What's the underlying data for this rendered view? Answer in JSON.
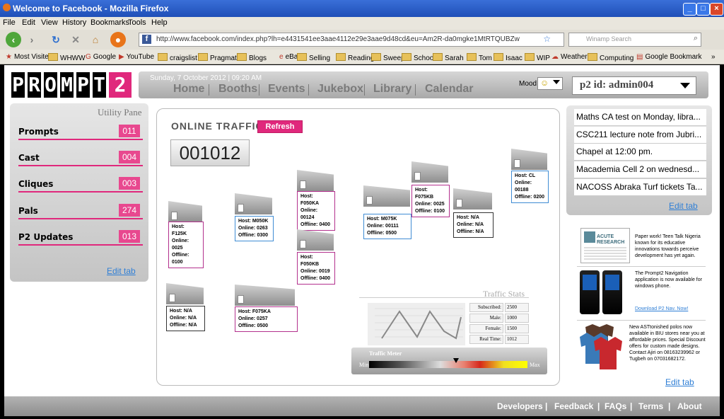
{
  "browser": {
    "window_title": "Welcome to Facebook - Mozilla Firefox",
    "menu": [
      "File",
      "Edit",
      "View",
      "History",
      "Bookmarks",
      "Tools",
      "Help"
    ],
    "url": "http://www.facebook.com/index.php?lh=e4431541ee3aae4112e29e3aae9d48cd&eu=Am2R-da0mgke1MtRTQUBZw",
    "search_placeholder": "Winamp Search",
    "bookmarks": [
      "Most Visited",
      "WHWW",
      "Google",
      "YouTube",
      "craigslist",
      "Pragmatic",
      "Blogs",
      "eBay",
      "Selling",
      "Reading",
      "Sweeps",
      "School",
      "Sarah",
      "Tom",
      "Isaac",
      "WIP",
      "Weather",
      "Computing",
      "Google Bookmark"
    ],
    "bookmarks_more": "»"
  },
  "header": {
    "logo": "PROMPT2",
    "date": "Sunday, 7 October 2012  |  09:20 AM",
    "nav": [
      "Home",
      "Booths",
      "Events",
      "Jukebox",
      "Library",
      "Calendar"
    ],
    "mood_label": "Mood",
    "mood_value": "☺",
    "p2id": "p2 id: admin004"
  },
  "left": {
    "title": "Utility Pane",
    "items": [
      {
        "label": "Prompts",
        "count": "011"
      },
      {
        "label": "Cast",
        "count": "004"
      },
      {
        "label": "Cliques",
        "count": "003"
      },
      {
        "label": "Pals",
        "count": "274"
      },
      {
        "label": "P2 Updates",
        "count": "013"
      }
    ],
    "edit": "Edit tab"
  },
  "center": {
    "title": "ONLINE TRAFFIC",
    "refresh": "Refresh",
    "counter": "001012",
    "booths": [
      {
        "host": "Host: F125K",
        "online": "Online: 0025",
        "offline": "Offline: 0100"
      },
      {
        "host": "Host: M050K",
        "online": "Online: 0263",
        "offline": "Offline: 0300"
      },
      {
        "host": "Host: F050KA",
        "online": "Online: 00124",
        "offline": "Offline: 0400"
      },
      {
        "host": "Host: F050KB",
        "online": "Online: 0019",
        "offline": "Offline: 0400"
      },
      {
        "host": "Host: M075K",
        "online": "Online: 00111",
        "offline": "Offline: 0500"
      },
      {
        "host": "Host: F075KB",
        "online": "Online: 0025",
        "offline": "Offline: 0100"
      },
      {
        "host": "Host: N/A",
        "online": "Online: N/A",
        "offline": "Offline: N/A"
      },
      {
        "host": "Host: CL",
        "online": "Online: 00188",
        "offline": "Offline: 0200"
      },
      {
        "host": "Host: N/A",
        "online": "Online: N/A",
        "offline": "Offline: N/A"
      },
      {
        "host": "Host: F075KA",
        "online": "Online: 0257",
        "offline": "Offline: 0500"
      }
    ],
    "stats_title": "Traffic Stats",
    "stats": [
      {
        "label": "Subscribed:",
        "value": "2500"
      },
      {
        "label": "Male:",
        "value": "1000"
      },
      {
        "label": "Female:",
        "value": "1500"
      },
      {
        "label": "Real Time:",
        "value": "1012"
      }
    ],
    "meter_title": "Traffic Meter",
    "meter_min": "Min",
    "meter_max": "Max",
    "meter_level": 0.55
  },
  "right": {
    "news": [
      "Maths CA test on Monday, libra...",
      "CSC211 lecture note from Jubri...",
      "Chapel at 12:00 pm.",
      "Macademia Cell 2 on wednesd...",
      "NACOSS Abraka Turf tickets Ta..."
    ],
    "edit": "Edit tab",
    "ads": [
      {
        "image_text": "ACUTE RESEARCH",
        "text": "Paper work! Teen Talk Nigeria known for its educative innovations towards perceive development has yet again."
      },
      {
        "text": "The Prompt2 Navigation application is now available for windows phone.",
        "link": "Download P2 Nav. Now!"
      },
      {
        "text": "New ASTtonished polos now available in BIU stores near you at affordable prices. Special Discount offers for custom made designs.\nContact Ajiri on 08163239962 or Tugbeh on 07031682172."
      }
    ],
    "edit2": "Edit tab"
  },
  "footer": {
    "links": [
      "Developers",
      "Feedback",
      "FAQs",
      "Terms",
      "About"
    ]
  }
}
